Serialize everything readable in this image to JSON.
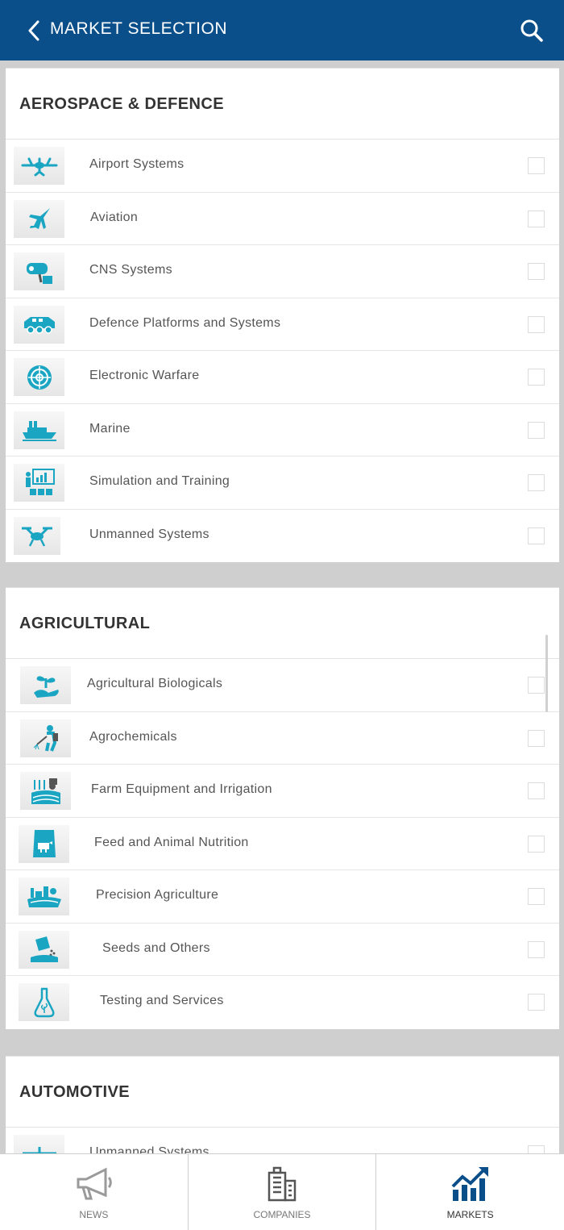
{
  "header": {
    "title": "MARKET SELECTION",
    "back_icon": "chevron-left-icon",
    "search_icon": "search-icon"
  },
  "colors": {
    "brand": "#0b4f8a",
    "icon_accent": "#1aa6c2",
    "tab_active": "#0b4f8a",
    "tab_inactive": "#9a9a9a"
  },
  "sections": [
    {
      "title": "AEROSPACE & DEFENCE",
      "items": [
        {
          "label": "Airport Systems",
          "icon": "airplane-icon"
        },
        {
          "label": "Aviation",
          "icon": "fighter-jet-icon"
        },
        {
          "label": "CNS Systems",
          "icon": "radar-camera-icon"
        },
        {
          "label": "Defence Platforms and Systems",
          "icon": "armored-vehicle-icon"
        },
        {
          "label": "Electronic Warfare",
          "icon": "target-icon"
        },
        {
          "label": "Marine",
          "icon": "ship-icon"
        },
        {
          "label": "Simulation and Training",
          "icon": "presentation-icon"
        },
        {
          "label": "Unmanned Systems",
          "icon": "drone-icon"
        }
      ]
    },
    {
      "title": "AGRICULTURAL",
      "items": [
        {
          "label": "Agricultural Biologicals",
          "icon": "plant-hand-icon"
        },
        {
          "label": "Agrochemicals",
          "icon": "sprayer-person-icon"
        },
        {
          "label": "Farm Equipment and Irrigation",
          "icon": "tractor-icon"
        },
        {
          "label": "Feed and Animal Nutrition",
          "icon": "feed-bag-icon"
        },
        {
          "label": "Precision Agriculture",
          "icon": "farm-field-icon"
        },
        {
          "label": "Seeds and Others",
          "icon": "seeds-icon"
        },
        {
          "label": "Testing and Services",
          "icon": "flask-icon"
        }
      ]
    },
    {
      "title": "AUTOMOTIVE",
      "items": [
        {
          "label": "Unmanned Systems",
          "icon": "airplane-icon"
        }
      ]
    }
  ],
  "tabs": [
    {
      "label": "NEWS",
      "icon": "megaphone-icon",
      "active": false
    },
    {
      "label": "COMPANIES",
      "icon": "building-icon",
      "active": false
    },
    {
      "label": "MARKETS",
      "icon": "chart-up-icon",
      "active": true
    }
  ]
}
